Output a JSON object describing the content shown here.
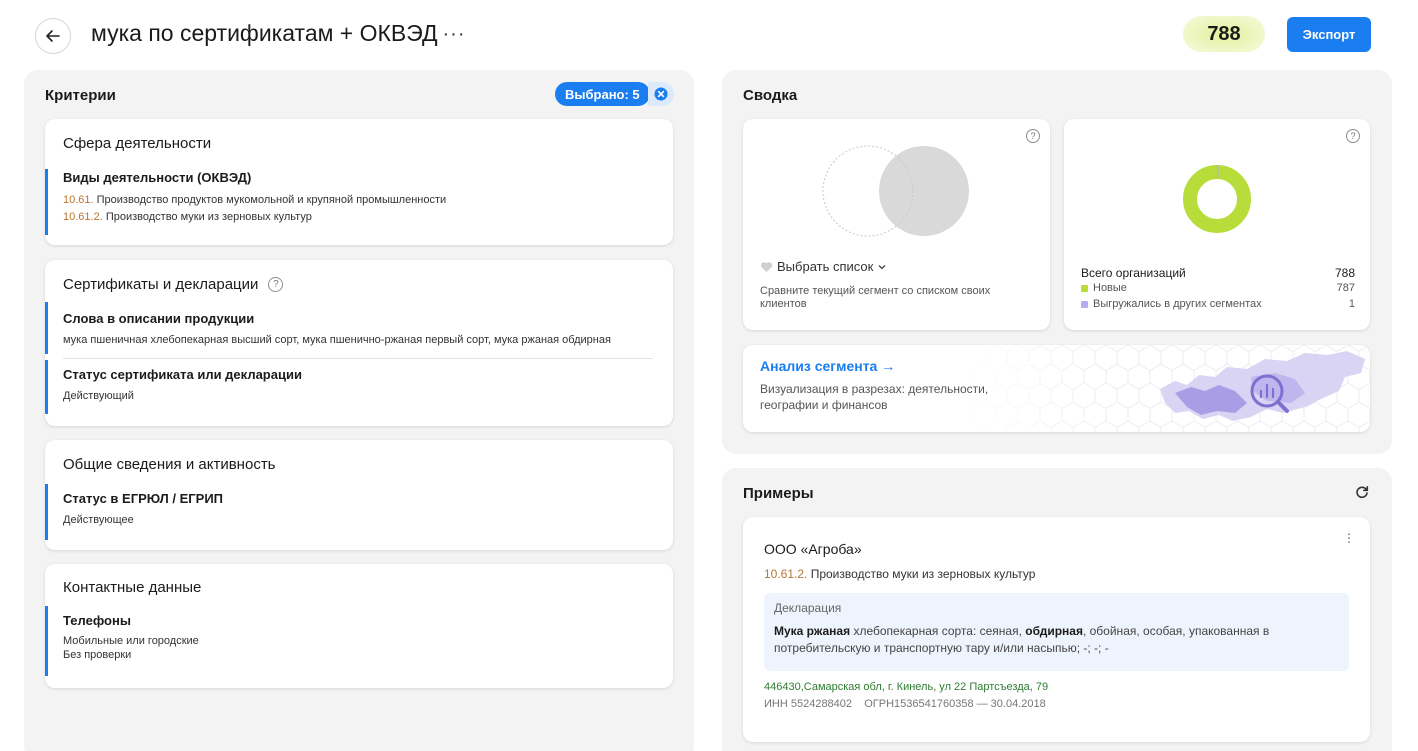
{
  "header": {
    "title": "мука по сертификатам + ОКВЭД",
    "more_label": "···",
    "count": "788",
    "export_label": "Экспорт"
  },
  "criteria": {
    "title": "Критерии",
    "selected_label": "Выбрано: 5",
    "groups": [
      {
        "title": "Сфера деятельности",
        "items": [
          {
            "name": "Виды деятельности (ОКВЭД)",
            "lines": [
              {
                "code": "10.61.",
                "text": " Производство продуктов мукомольной и крупяной промышленности"
              },
              {
                "code": "10.61.2.",
                "text": " Производство муки из зерновых культур"
              }
            ]
          }
        ]
      },
      {
        "title": "Сертификаты и декларации",
        "items": [
          {
            "name": "Слова в описании продукции",
            "value": "мука пшеничная хлебопекарная высший сорт, мука пшенично-ржаная первый сорт, мука ржаная обдирная"
          },
          {
            "name": "Статус сертификата или декларации",
            "value": "Действующий"
          }
        ]
      },
      {
        "title": "Общие сведения и активность",
        "items": [
          {
            "name": "Статус в ЕГРЮЛ / ЕГРИП",
            "value": "Действующее"
          }
        ]
      },
      {
        "title": "Контактные данные",
        "items": [
          {
            "name": "Телефоны",
            "value1": "Мобильные или городские",
            "value2": "Без проверки"
          }
        ]
      }
    ]
  },
  "summary": {
    "title": "Сводка",
    "compare": {
      "pick_label": "Выбрать список",
      "desc": "Сравните текущий сегмент со списком своих клиентов"
    },
    "stats": {
      "total_label": "Всего организаций",
      "total_value": "788",
      "new_label": "Новые",
      "new_value": "787",
      "exported_label": "Выгружались в других сегментах",
      "exported_value": "1",
      "new_color": "#b8dd3a",
      "exported_color": "#b7aef0"
    },
    "analysis": {
      "title": "Анализ сегмента →",
      "desc": "Визуализация в разрезах: деятельности, географии и финансов"
    }
  },
  "examples": {
    "title": "Примеры",
    "card": {
      "name": "ООО «Агроба»",
      "okved_code": "10.61.2.",
      "okved_text": " Производство муки из зерновых культур",
      "decl_title": "Декларация",
      "decl_bold1": "Мука ржаная",
      "decl_text1": " хлебопекарная сорта: сеяная, ",
      "decl_bold2": "обдирная",
      "decl_text2": ", обойная, особая, упакованная в потребительскую и транспортную тару и/или насыпью; -; -; -",
      "address": "446430,Самарская обл, г. Кинель, ул 22 Партсъезда, 79",
      "ids": "ИНН 5524288402    ОГРН1536541760358 — 30.04.2018"
    }
  },
  "colors": {
    "accent": "#1a7df0",
    "okved_code": "#b8752f",
    "address": "#2e7d32"
  }
}
